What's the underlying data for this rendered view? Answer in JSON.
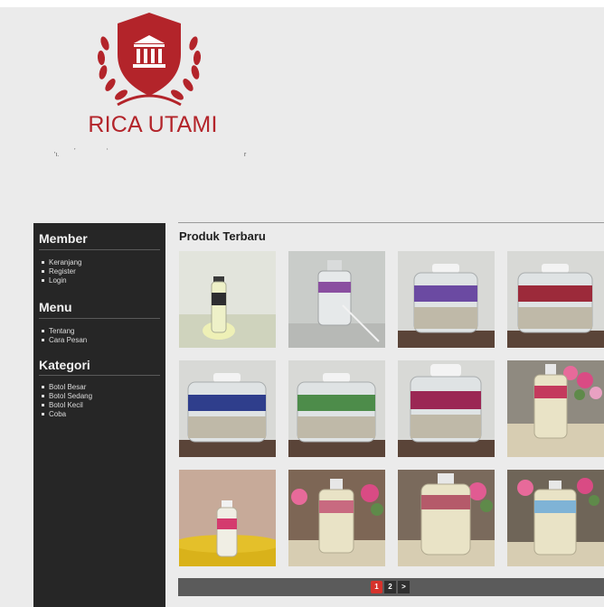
{
  "brand": {
    "name": "RICA UTAMI",
    "tagline_fragments": [
      "'ı.",
      "’",
      "‘",
      "r"
    ],
    "colors": {
      "primary": "#b3242a"
    }
  },
  "sidebar": {
    "sections": [
      {
        "title": "Member",
        "items": [
          "Keranjang",
          "Register",
          "Login"
        ]
      },
      {
        "title": "Menu",
        "items": [
          "Tentang",
          "Cara Pesan"
        ]
      },
      {
        "title": "Kategori",
        "items": [
          "Botol Besar",
          "Botol Sedang",
          "Botol Kecil",
          "Coba"
        ]
      }
    ]
  },
  "main": {
    "section_title": "Produk Terbaru",
    "products": [
      {
        "icon": "small-bottle-photo"
      },
      {
        "icon": "glass-bottle-photo"
      },
      {
        "icon": "jar-purple-label-photo"
      },
      {
        "icon": "jar-red-label-photo"
      },
      {
        "icon": "jar-blue-label-photo"
      },
      {
        "icon": "jar-green-label-photo"
      },
      {
        "icon": "jar-magenta-label-photo"
      },
      {
        "icon": "bottle-with-flowers-photo"
      },
      {
        "icon": "small-bottle-on-yellow-photo"
      },
      {
        "icon": "bottle-with-flowers-photo"
      },
      {
        "icon": "bottle-with-flowers-photo"
      },
      {
        "icon": "bottle-with-flowers-photo"
      }
    ]
  },
  "pagination": {
    "pages": [
      "1",
      "2"
    ],
    "next": ">",
    "current": "1"
  }
}
